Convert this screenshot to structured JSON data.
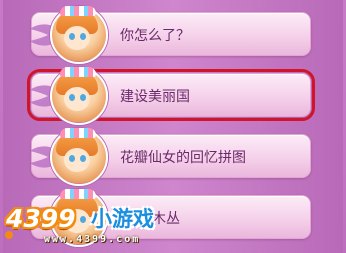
{
  "options": [
    {
      "label": "你怎么了？"
    },
    {
      "label": "建设美丽国"
    },
    {
      "label": "花瓣仙女的回忆拼图"
    },
    {
      "label": "灌木丛"
    }
  ],
  "selected_index": 1,
  "logo": {
    "number": "4399",
    "text": "小游戏",
    "url": "www.4399.com"
  },
  "colors": {
    "background": "#c476c4",
    "option_fill": "#f5d1ea",
    "selection_outline": "#d0152a",
    "label": "#6a2a6a"
  }
}
